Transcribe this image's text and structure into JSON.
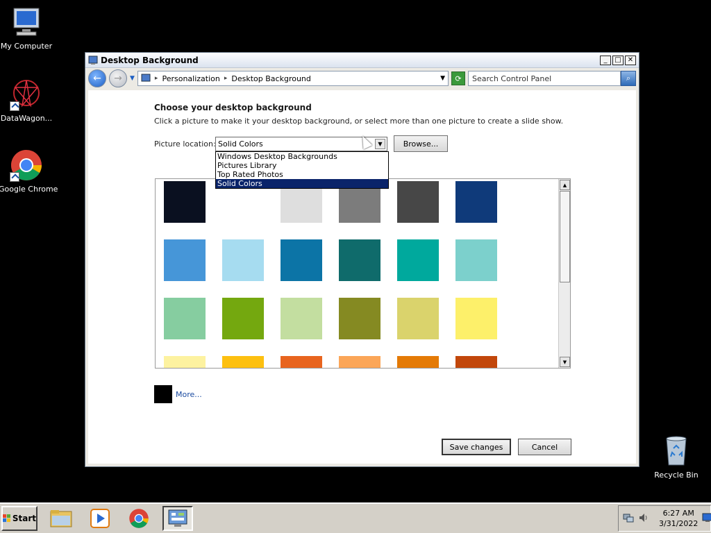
{
  "desktop": {
    "icons": [
      {
        "label": "My Computer"
      },
      {
        "label": "DataWagon..."
      },
      {
        "label": "Google Chrome"
      },
      {
        "label": "Recycle Bin"
      }
    ]
  },
  "window": {
    "title": "Desktop Background",
    "breadcrumb": [
      "Personalization",
      "Desktop Background"
    ],
    "search_placeholder": "Search Control Panel",
    "heading": "Choose your desktop background",
    "description": "Click a picture to make it your desktop background, or select more than one picture to create a slide show.",
    "picture_location_label": "Picture location:",
    "picture_location_value": "Solid Colors",
    "browse_label": "Browse...",
    "dropdown_options": [
      "Windows Desktop Backgrounds",
      "Pictures Library",
      "Top Rated Photos",
      "Solid Colors"
    ],
    "swatches": [
      [
        "#0a1020",
        "#ffffff",
        "#dedede",
        "#7c7c7c",
        "#474747",
        "#0f3a7a"
      ],
      [
        "#4696d8",
        "#a6dcf0",
        "#0c74a6",
        "#0f6b6b",
        "#00a99d",
        "#7cd0cc"
      ],
      [
        "#86cda0",
        "#74a80f",
        "#c3dea0",
        "#858a22",
        "#dad36c",
        "#fdf06a"
      ],
      [
        "#fdf2a0",
        "#fdc010",
        "#e8641e",
        "#fba658",
        "#e47a06",
        "#c2470b"
      ]
    ],
    "more_label": "More...",
    "save_label": "Save changes",
    "cancel_label": "Cancel"
  },
  "taskbar": {
    "start_label": "Start",
    "time": "6:27 AM",
    "date": "3/31/2022"
  }
}
